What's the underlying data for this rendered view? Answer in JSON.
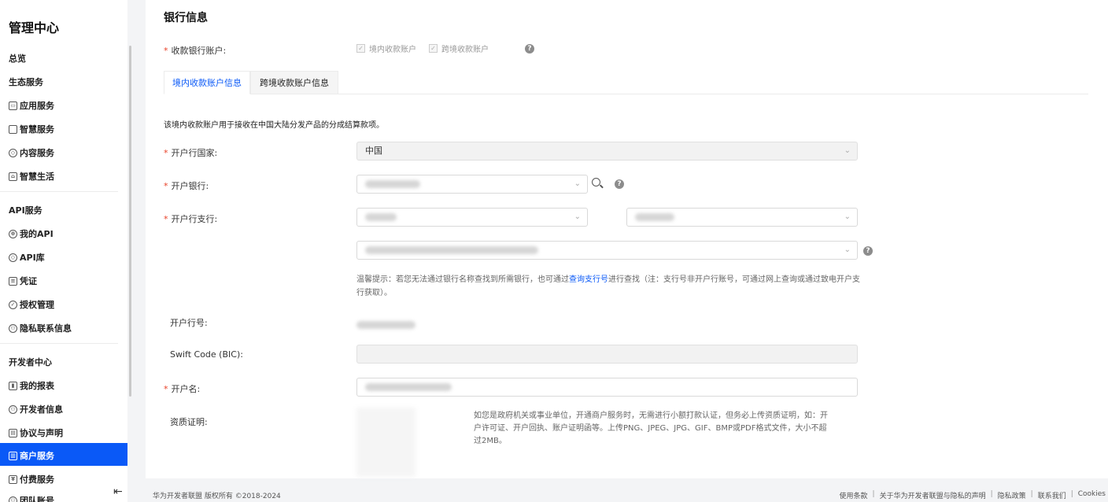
{
  "sidebar": {
    "title": "管理中心",
    "items": [
      {
        "label": "总览",
        "icon": "none"
      },
      {
        "label": "生态服务",
        "icon": "none"
      },
      {
        "label": "应用服务",
        "icon": "app-icon"
      },
      {
        "label": "智慧服务",
        "icon": "monitor-icon"
      },
      {
        "label": "内容服务",
        "icon": "layers-icon"
      },
      {
        "label": "智慧生活",
        "icon": "home-icon"
      },
      {
        "label": "API服务",
        "icon": "none"
      },
      {
        "label": "我的API",
        "icon": "api-icon"
      },
      {
        "label": "API库",
        "icon": "cube-icon"
      },
      {
        "label": "凭证",
        "icon": "credential-icon"
      },
      {
        "label": "授权管理",
        "icon": "shield-icon"
      },
      {
        "label": "隐私联系信息",
        "icon": "user-icon"
      },
      {
        "label": "开发者中心",
        "icon": "none"
      },
      {
        "label": "我的报表",
        "icon": "chart-icon"
      },
      {
        "label": "开发者信息",
        "icon": "user-icon"
      },
      {
        "label": "协议与声明",
        "icon": "doc-icon"
      },
      {
        "label": "商户服务",
        "icon": "merchant-icon"
      },
      {
        "label": "付费服务",
        "icon": "pay-icon"
      },
      {
        "label": "团队账号",
        "icon": "team-icon"
      }
    ],
    "active": "商户服务"
  },
  "main": {
    "title": "银行信息",
    "account_label": "收款银行账户:",
    "checkbox_domestic": "境内收款账户",
    "checkbox_cross": "跨境收款账户",
    "tabs": [
      {
        "label": "境内收款账户信息",
        "active": true
      },
      {
        "label": "跨境收款账户信息",
        "active": false
      }
    ],
    "description": "该境内收款账户用于接收在中国大陆分发产品的分成结算款项。",
    "country_label": "开户行国家:",
    "country_value": "中国",
    "bank_label": "开户银行:",
    "branch_label": "开户行支行:",
    "hint_prefix": "温馨提示：若您无法通过银行名称查找到所需银行，也可通过",
    "hint_link": "查询支行号",
    "hint_suffix": "进行查找（注：支行号非开户行账号，可通过网上查询或通过致电开户支行获取）。",
    "bank_code_label": "开户行号:",
    "swift_label": "Swift Code (BIC):",
    "account_name_label": "开户名:",
    "qualification_label": "资质证明:",
    "qualification_note": "如您是政府机关或事业单位，开通商户服务时，无需进行小额打款认证，但务必上传资质证明，如：开户许可证、开户回执、账户证明函等。上传PNG、JPEG、JPG、GIF、BMP或PDF格式文件，大小不超过2MB。"
  },
  "footer": {
    "copyright": "华为开发者联盟 版权所有 ©2018-2024",
    "links": [
      "使用条款",
      "关于华为开发者联盟与隐私的声明",
      "隐私政策",
      "联系我们",
      "Cookies"
    ]
  }
}
